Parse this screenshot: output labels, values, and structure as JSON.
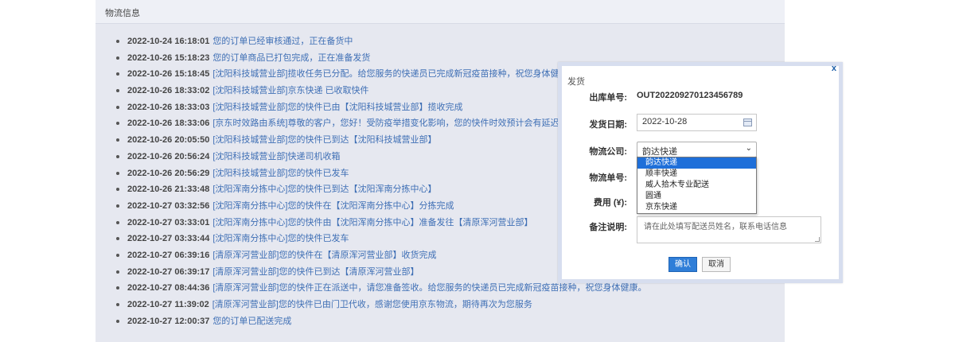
{
  "panel": {
    "title": "物流信息",
    "tracking": [
      {
        "time": "2022-10-24 16:18:01",
        "message": "您的订单已经审核通过，正在备货中"
      },
      {
        "time": "2022-10-26 15:18:23",
        "message": "您的订单商品已打包完成，正在准备发货"
      },
      {
        "time": "2022-10-26 15:18:45",
        "message": "[沈阳科技城营业部]揽收任务已分配。给您服务的快递员已完成新冠疫苗接种，祝您身体健康。"
      },
      {
        "time": "2022-10-26 18:33:02",
        "message": "[沈阳科技城营业部]京东快递 已收取快件"
      },
      {
        "time": "2022-10-26 18:33:03",
        "message": "[沈阳科技城营业部]您的快件已由【沈阳科技城营业部】揽收完成"
      },
      {
        "time": "2022-10-26 18:33:06",
        "message": "[京东时效路由系统]尊敬的客户，您好！受防疫举措变化影响，您的快件时效预计会有延迟，建议您暂"
      },
      {
        "time": "2022-10-26 20:05:50",
        "message": "[沈阳科技城营业部]您的快件已到达【沈阳科技城营业部】"
      },
      {
        "time": "2022-10-26 20:56:24",
        "message": "[沈阳科技城营业部]快递司机收箱"
      },
      {
        "time": "2022-10-26 20:56:29",
        "message": "[沈阳科技城营业部]您的快件已发车"
      },
      {
        "time": "2022-10-26 21:33:48",
        "message": "[沈阳浑南分拣中心]您的快件已到达【沈阳浑南分拣中心】"
      },
      {
        "time": "2022-10-27 03:32:56",
        "message": "[沈阳浑南分拣中心]您的快件在【沈阳浑南分拣中心】分拣完成"
      },
      {
        "time": "2022-10-27 03:33:01",
        "message": "[沈阳浑南分拣中心]您的快件由【沈阳浑南分拣中心】准备发往【清原浑河营业部】"
      },
      {
        "time": "2022-10-27 03:33:44",
        "message": "[沈阳浑南分拣中心]您的快件已发车"
      },
      {
        "time": "2022-10-27 06:39:16",
        "message": "[清原浑河营业部]您的快件在【清原浑河营业部】收货完成"
      },
      {
        "time": "2022-10-27 06:39:17",
        "message": "[清原浑河营业部]您的快件已到达【清原浑河营业部】"
      },
      {
        "time": "2022-10-27 08:44:36",
        "message": "[清原浑河营业部]您的快件正在派送中，请您准备签收。给您服务的快递员已完成新冠疫苗接种，祝您身体健康。"
      },
      {
        "time": "2022-10-27 11:39:02",
        "message": "[清原浑河营业部]您的快件已由门卫代收，感谢您使用京东物流，期待再次为您服务"
      },
      {
        "time": "2022-10-27 12:00:37",
        "message": "您的订单已配送完成"
      }
    ]
  },
  "dialog": {
    "title": "发货",
    "close": "x",
    "order_label": "出库单号:",
    "order_value": "OUT202209270123456789",
    "date_label": "发货日期:",
    "date_value": "2022-10-28",
    "company_label": "物流公司:",
    "company_value": "韵达快递",
    "company_arrow": "⌄",
    "company_options": [
      "韵达快递",
      "顺丰快递",
      "威人拾木专业配送",
      "圆通",
      "京东快递"
    ],
    "tracking_label": "物流单号:",
    "fee_label": "费用 (¥):",
    "remark_label": "备注说明:",
    "remark_placeholder": "请在此处填写配送员姓名，联系电话信息",
    "confirm": "确认",
    "cancel": "取消",
    "accent_color": "#2f7ed8"
  }
}
